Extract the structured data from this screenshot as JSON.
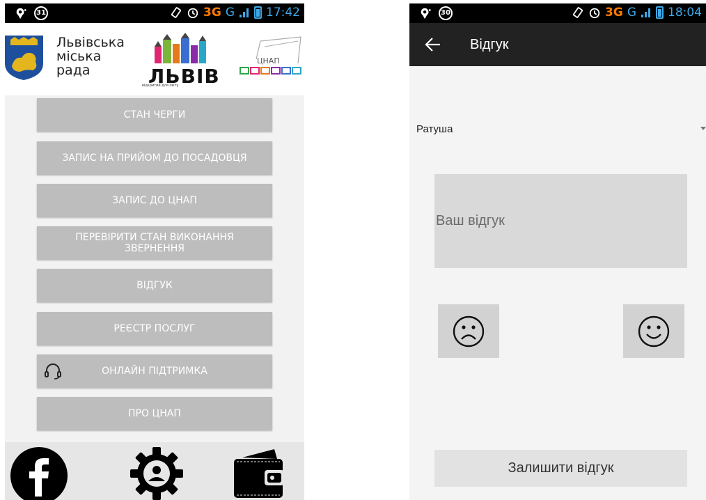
{
  "left_screen": {
    "status_bar": {
      "notification_count": "31",
      "network": "3G",
      "signal_label": "G",
      "time": "17:42"
    },
    "header": {
      "council_name": "Львівська\nміська\nрада",
      "city_logo_word": "ЛЬВІВ",
      "city_logo_tagline": "відкритий для світу",
      "cnap_logo_word": "ЦНАП"
    },
    "menu": [
      {
        "label": "СТАН ЧЕРГИ"
      },
      {
        "label": "ЗАПИС НА ПРИЙОМ ДО ПОСАДОВЦЯ"
      },
      {
        "label": "ЗАПИС ДО ЦНАП"
      },
      {
        "label": "ПЕРЕВІРИТИ СТАН ВИКОНАННЯ ЗВЕРНЕННЯ"
      },
      {
        "label": "ВІДГУК"
      },
      {
        "label": "РЕЄСТР ПОСЛУГ"
      },
      {
        "label": "ОНЛАЙН ПІДТРИМКА",
        "icon": "headset-icon"
      },
      {
        "label": "ПРО ЦНАП"
      }
    ],
    "bottom_bar": {
      "icons": [
        "facebook-icon",
        "gear-icon",
        "wallet-icon"
      ]
    }
  },
  "right_screen": {
    "status_bar": {
      "notification_count": "30",
      "network": "3G",
      "signal_label": "G",
      "time": "18:04"
    },
    "app_bar": {
      "title": "Відгук",
      "back_icon": "back-arrow-icon"
    },
    "location_select": {
      "selected": "Ратуша"
    },
    "feedback_input": {
      "placeholder": "Ваш відгук",
      "value": ""
    },
    "mood_buttons": {
      "sad_icon": "sad-face-icon",
      "happy_icon": "happy-face-icon"
    },
    "submit_label": "Залишити відгук"
  },
  "colors": {
    "menu_button_bg": "#bdbdbd",
    "menu_button_text": "#ffffff",
    "app_bar_bg": "#222222",
    "status_time_blue": "#3ea8e6",
    "status_network_orange": "#ff7a00"
  }
}
